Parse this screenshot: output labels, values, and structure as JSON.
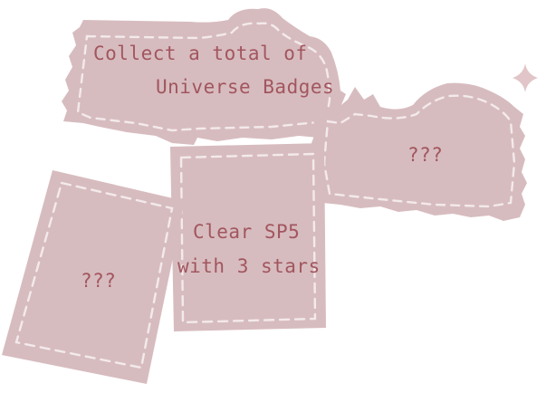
{
  "palette": {
    "card_fill": "#d7bcbf",
    "card_fill_light": "#e3cfd1",
    "stitch": "#f3eaeb",
    "text": "#a2565f",
    "background": "#ffffff"
  },
  "cards": [
    {
      "id": "universe-badges",
      "line1": "Collect a total of",
      "line2": "Universe Badges",
      "state": "visible"
    },
    {
      "id": "mystery-right",
      "label": "???",
      "state": "hidden"
    },
    {
      "id": "clear-sp5",
      "line1": "Clear SP5",
      "line2": "with 3 stars",
      "state": "visible"
    },
    {
      "id": "mystery-left",
      "label": "???",
      "state": "hidden"
    }
  ],
  "decoration": {
    "sparkle_icon": "sparkle-star-icon"
  }
}
